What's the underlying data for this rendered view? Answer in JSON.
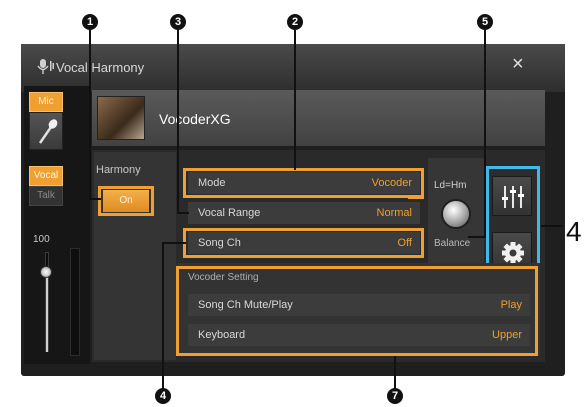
{
  "window": {
    "title": "Vocal Harmony",
    "close_glyph": "×"
  },
  "left_panel": {
    "mic_tab": "Mic",
    "vocal_tab": "Vocal",
    "talk_tab": "Talk",
    "volume_value": "100",
    "volume_level": 0.8
  },
  "preset": {
    "name": "VocoderXG"
  },
  "harmony": {
    "label": "Harmony",
    "toggle": "On"
  },
  "settings": {
    "mode_label": "Mode",
    "mode_value": "Vocoder",
    "vocal_range_label": "Vocal Range",
    "vocal_range_value": "Normal",
    "song_ch_label": "Song Ch",
    "song_ch_value": "Off"
  },
  "balance": {
    "top_label": "Ld=Hm",
    "label": "Balance"
  },
  "vocoder_setting": {
    "title": "Vocoder Setting",
    "mute_label": "Song Ch Mute/Play",
    "mute_value": "Play",
    "keyboard_label": "Keyboard",
    "keyboard_value": "Upper"
  },
  "callouts": {
    "n1": "1",
    "n2": "2",
    "n3": "3",
    "n4": "4",
    "n5": "5",
    "n7": "7",
    "side_4": "4"
  },
  "colors": {
    "accent_orange": "#f0a030",
    "highlight_blue": "#40b8e8",
    "panel_dark": "#1f1f1f"
  },
  "icons": [
    "mic-icon",
    "microphone-icon",
    "mixer-icon",
    "gear-icon",
    "close-icon"
  ]
}
